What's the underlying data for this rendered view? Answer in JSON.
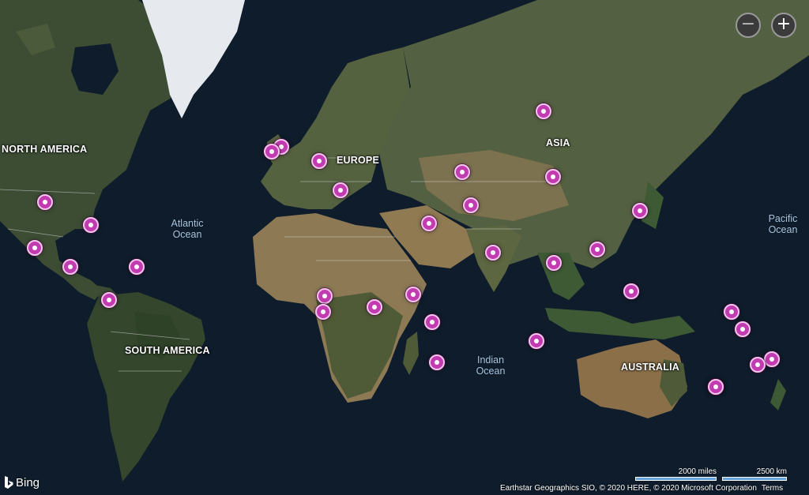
{
  "map": {
    "continent_labels": {
      "north_america": "NORTH AMERICA",
      "europe": "EUROPE",
      "asia": "ASIA",
      "south_america": "SOUTH AMERICA",
      "australia": "AUSTRALIA"
    },
    "ocean_labels": {
      "atlantic": "Atlantic Ocean",
      "indian": "Indian Ocean",
      "pacific": "Pacific Ocean"
    },
    "pins": [
      {
        "id": "pin-1"
      },
      {
        "id": "pin-2"
      },
      {
        "id": "pin-3"
      },
      {
        "id": "pin-4"
      },
      {
        "id": "pin-5"
      },
      {
        "id": "pin-6"
      },
      {
        "id": "pin-7"
      },
      {
        "id": "pin-8"
      },
      {
        "id": "pin-9"
      },
      {
        "id": "pin-10"
      },
      {
        "id": "pin-11"
      },
      {
        "id": "pin-12"
      },
      {
        "id": "pin-13"
      },
      {
        "id": "pin-14"
      },
      {
        "id": "pin-15"
      },
      {
        "id": "pin-16"
      },
      {
        "id": "pin-17"
      },
      {
        "id": "pin-18"
      },
      {
        "id": "pin-19"
      },
      {
        "id": "pin-20"
      },
      {
        "id": "pin-21"
      },
      {
        "id": "pin-22"
      },
      {
        "id": "pin-23"
      },
      {
        "id": "pin-24"
      },
      {
        "id": "pin-25"
      },
      {
        "id": "pin-26"
      },
      {
        "id": "pin-27"
      },
      {
        "id": "pin-28"
      },
      {
        "id": "pin-29"
      },
      {
        "id": "pin-30"
      },
      {
        "id": "pin-31"
      },
      {
        "id": "pin-32"
      },
      {
        "id": "pin-33"
      }
    ],
    "pin_color": "#c23bb0"
  },
  "controls": {
    "zoom_out_icon": "minus-icon",
    "zoom_in_icon": "plus-icon",
    "zoom_out_label": "−",
    "zoom_in_label": "+"
  },
  "footer": {
    "logo_text": "Bing",
    "scale_miles": "2000 miles",
    "scale_km": "2500 km",
    "attribution": "Earthstar Geographics SIO, © 2020 HERE, © 2020 Microsoft Corporation",
    "terms": "Terms"
  },
  "colors": {
    "ocean": "#0f1c2b",
    "land": "#3c4d34",
    "ice": "#e6eaee",
    "desert": "#8d7a55",
    "borders": "#d8d8d8",
    "scale_bar": "#6aa4dc"
  }
}
